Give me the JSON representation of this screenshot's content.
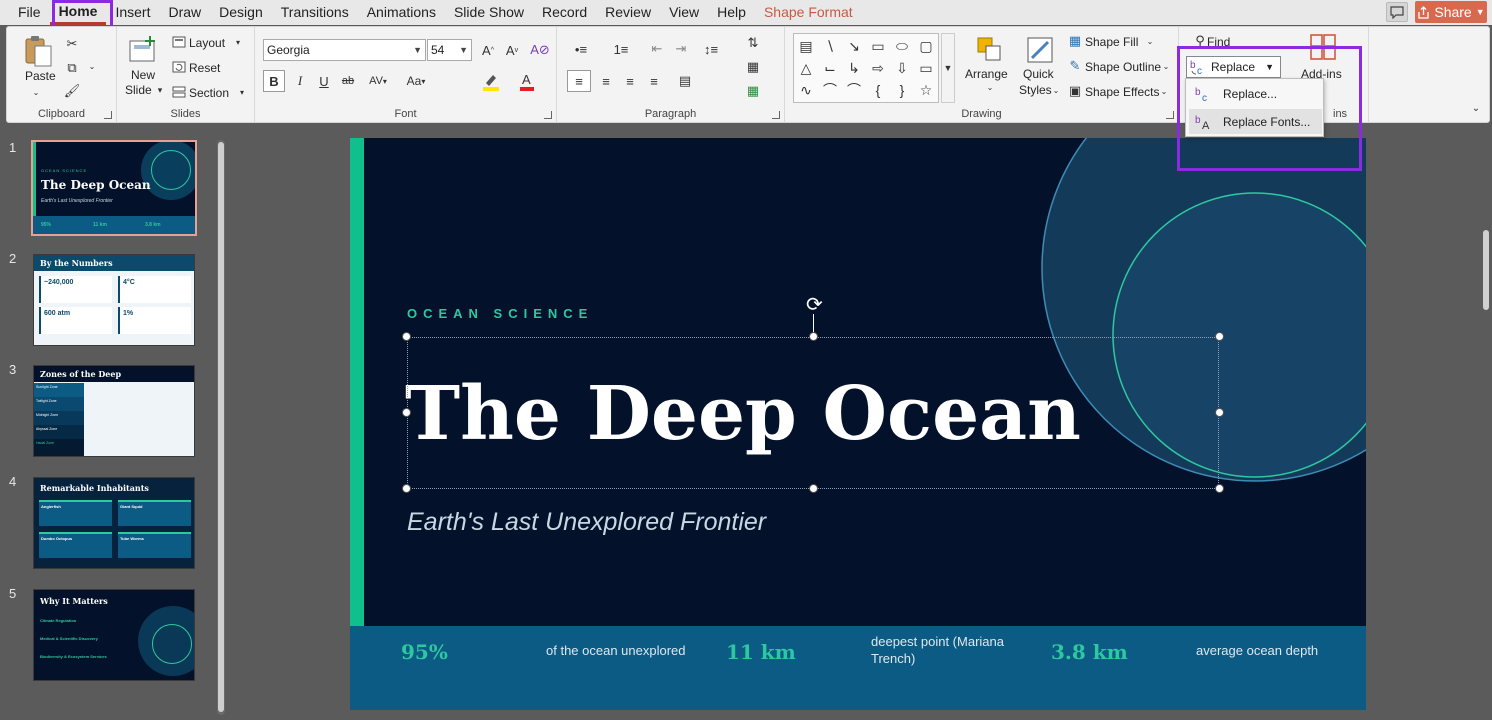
{
  "menu": {
    "tabs": [
      "File",
      "Home",
      "Insert",
      "Draw",
      "Design",
      "Transitions",
      "Animations",
      "Slide Show",
      "Record",
      "Review",
      "View",
      "Help",
      "Shape Format"
    ],
    "share_label": "Share"
  },
  "ribbon": {
    "clipboard": {
      "label": "Clipboard",
      "paste": "Paste"
    },
    "slides": {
      "label": "Slides",
      "new_slide_1": "New",
      "new_slide_2": "Slide",
      "layout": "Layout",
      "reset": "Reset",
      "section": "Section"
    },
    "font": {
      "label": "Font",
      "font_name": "Georgia",
      "font_size": "54",
      "bold": "B",
      "italic": "I",
      "underline": "U",
      "strike": "ab",
      "spacing": "AV",
      "case": "Aa"
    },
    "paragraph": {
      "label": "Paragraph"
    },
    "drawing": {
      "label": "Drawing",
      "arrange": "Arrange",
      "quick_1": "Quick",
      "quick_2": "Styles",
      "shape_fill": "Shape Fill",
      "shape_outline": "Shape Outline",
      "shape_effects": "Shape Effects"
    },
    "editing": {
      "find": "Find",
      "replace": "Replace",
      "menu_replace": "Replace...",
      "menu_replace_fonts": "Replace Fonts..."
    },
    "addins": {
      "label": "Add-ins",
      "group_label_partial": "ins"
    }
  },
  "slide": {
    "eyebrow": "OCEAN SCIENCE",
    "title": "The Deep Ocean",
    "subtitle": "Earth's Last Unexplored Frontier",
    "stats": [
      {
        "value": "95%",
        "label": "of the ocean unexplored"
      },
      {
        "value": "11 km",
        "label_1": "deepest point (Mariana",
        "label_2": "Trench)"
      },
      {
        "value": "3.8 km",
        "label": "average ocean depth"
      }
    ]
  },
  "thumbnails": [
    {
      "num": "1",
      "title": "The Deep Ocean",
      "sub": "Earth's Last Unexplored Frontier",
      "eyebrow": "OCEAN SCIENCE",
      "s1": "95%",
      "s2": "11 km",
      "s3": "3.8 km"
    },
    {
      "num": "2",
      "title": "By the Numbers",
      "c1": "~240,000",
      "c2": "4°C",
      "c3": "600 atm",
      "c4": "1%"
    },
    {
      "num": "3",
      "title": "Zones of the Deep",
      "z1": "Sunlight Zone",
      "z2": "Twilight Zone",
      "z3": "Midnight Zone",
      "z4": "Abyssal Zone",
      "z5": "Hadal Zone"
    },
    {
      "num": "4",
      "title": "Remarkable Inhabitants",
      "a1": "Anglerfish",
      "a2": "Giant Squid",
      "a3": "Dumbo Octopus",
      "a4": "Tube Worms"
    },
    {
      "num": "5",
      "title": "Why It Matters",
      "w1": "Climate Regulation",
      "w2": "Medical & Scientific Discovery",
      "w3": "Biodiversity & Ecosystem Services"
    }
  ],
  "colors": {
    "accent": "#10c08c",
    "slide_bg": "#03122a",
    "footer_bg": "#0b5b84",
    "highlight": "#8a2be2",
    "share": "#d9694e"
  }
}
